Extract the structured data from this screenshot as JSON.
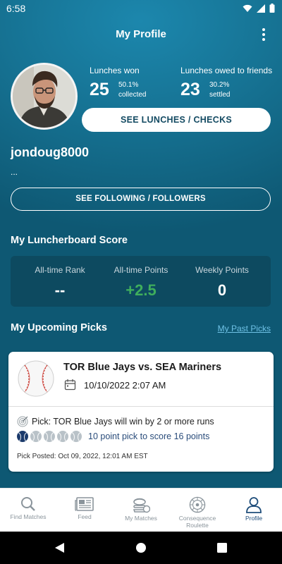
{
  "status_bar": {
    "time": "6:58"
  },
  "header": {
    "title": "My Profile"
  },
  "profile": {
    "lunches_won_label": "Lunches won",
    "lunches_won_value": "25",
    "lunches_won_pct": "50.1%",
    "lunches_won_sub": "collected",
    "lunches_owed_label": "Lunches owed to friends",
    "lunches_owed_value": "23",
    "lunches_owed_pct": "30.2%",
    "lunches_owed_sub": "settled",
    "see_lunches_button": "SEE LUNCHES / CHECKS",
    "username": "jondoug8000",
    "bio": "...",
    "following_button": "SEE FOLLOWING / FOLLOWERS"
  },
  "luncherboard": {
    "title": "My Luncherboard Score",
    "columns": [
      {
        "label": "All-time Rank",
        "value": "--",
        "color": "#ffffff"
      },
      {
        "label": "All-time Points",
        "value": "+2.5",
        "color": "#3fae5c"
      },
      {
        "label": "Weekly Points",
        "value": "0",
        "color": "#ffffff"
      }
    ]
  },
  "picks": {
    "title": "My Upcoming Picks",
    "past_link": "My Past Picks",
    "card": {
      "icon": "baseball-icon",
      "matchup": "TOR Blue Jays vs. SEA Mariners",
      "date": "10/10/2022 2:07 AM",
      "pick": "Pick: TOR Blue Jays will win by 2 or more runs",
      "confidence": 1,
      "confidence_max": 5,
      "points_text": "10 point pick to score 16 points",
      "posted": "Pick Posted: Oct 09, 2022, 12:01 AM EST"
    }
  },
  "nav": {
    "items": [
      {
        "label": "Find Matches",
        "icon": "search-icon"
      },
      {
        "label": "Feed",
        "icon": "newspaper-icon"
      },
      {
        "label": "My Matches",
        "icon": "my-matches-icon"
      },
      {
        "label": "Consequence Roulette",
        "icon": "roulette-icon"
      },
      {
        "label": "Profile",
        "icon": "person-icon"
      }
    ],
    "active": "Profile"
  },
  "colors": {
    "accent": "#156f92",
    "positive": "#3fae5c",
    "link": "#6fc2e6"
  }
}
